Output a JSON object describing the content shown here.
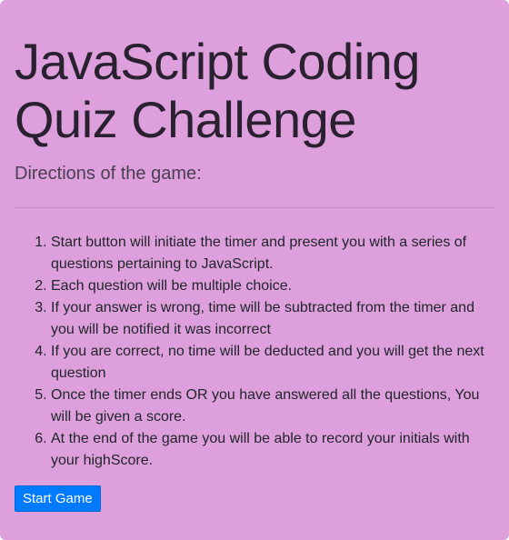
{
  "page": {
    "title": "JavaScript Coding Quiz Challenge",
    "lead": "Directions of the game:"
  },
  "directions": [
    "Start button will initiate the timer and present you with a series of questions pertaining to JavaScript.",
    "Each question will be multiple choice.",
    "If your answer is wrong, time will be subtracted from the timer and you will be notified it was incorrect",
    "If you are correct, no time will be deducted and you will get the next question",
    "Once the timer ends OR you have answered all the questions, You will be given a score.",
    "At the end of the game you will be able to record your initials with your highScore."
  ],
  "actions": {
    "start_label": "Start Game"
  },
  "colors": {
    "background": "#dda0dd",
    "button": "#007bff"
  }
}
